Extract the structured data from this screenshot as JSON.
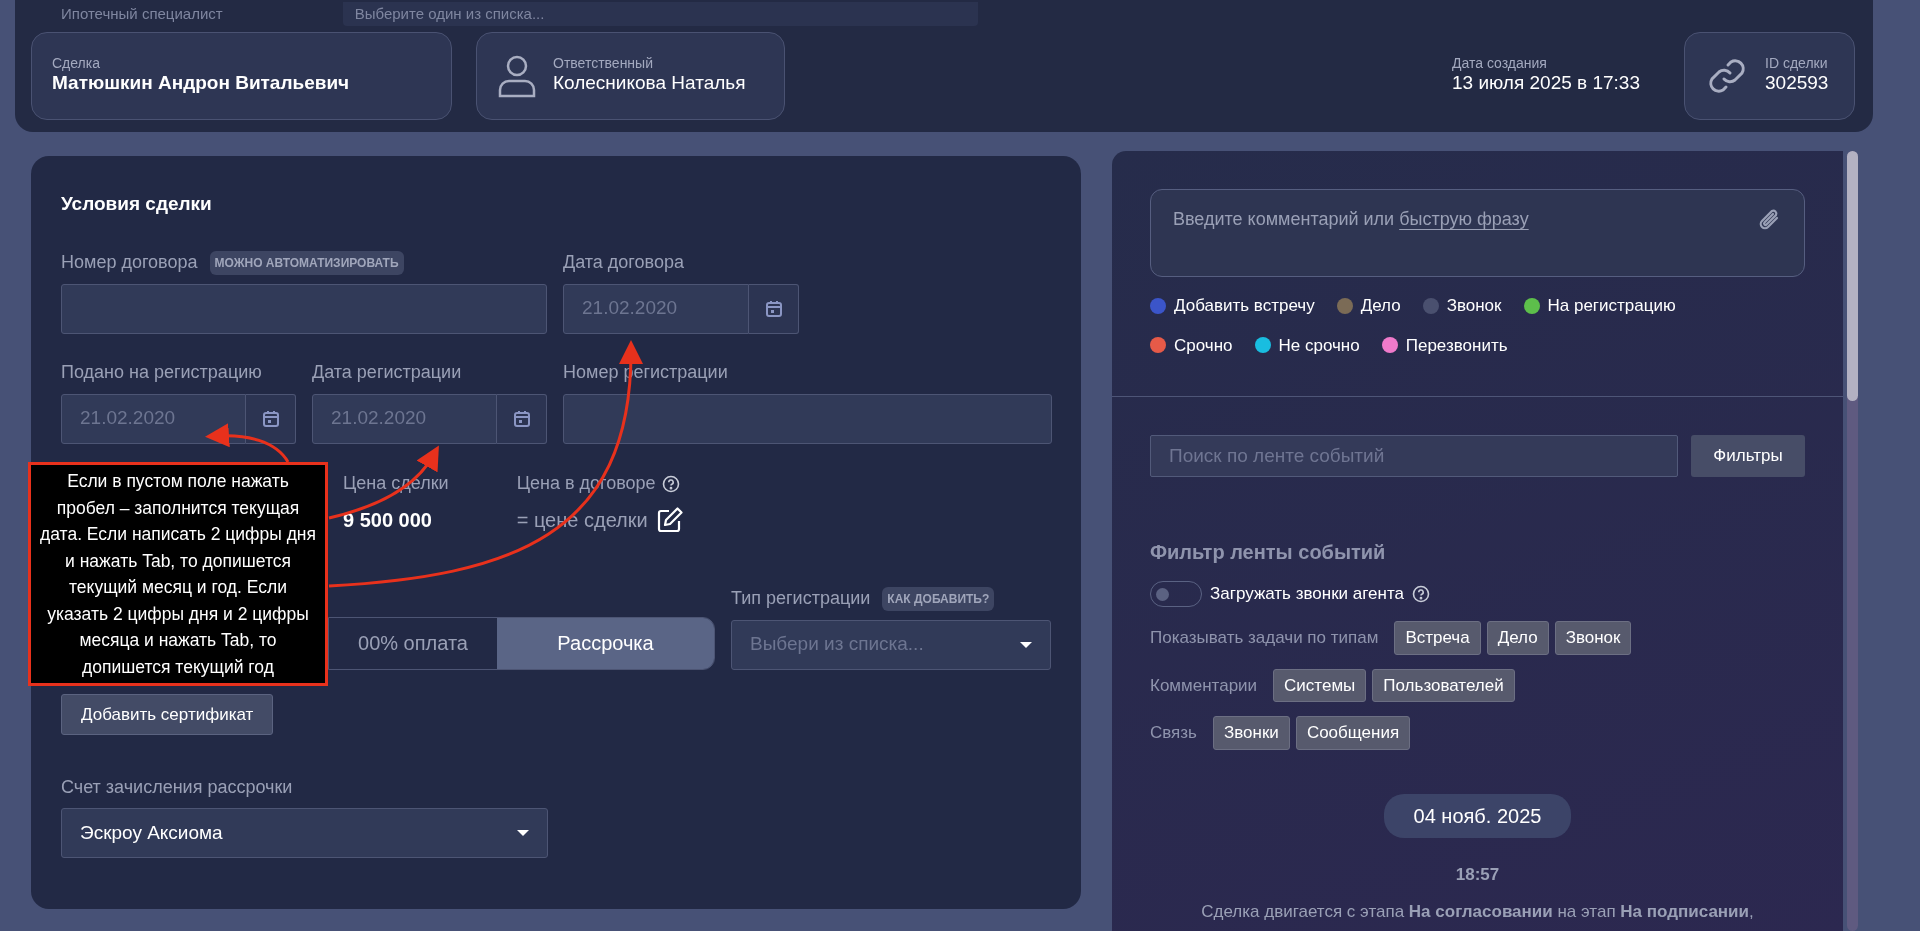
{
  "background_form": {
    "label": "Ипотечный специалист",
    "placeholder": "Выберите один из списка..."
  },
  "header": {
    "deal": {
      "label": "Сделка",
      "value": "Матюшкин Андрон Витальевич"
    },
    "responsible": {
      "label": "Ответственный",
      "value": "Колесникова Наталья"
    },
    "created": {
      "label": "Дата создания",
      "value": "13 июля 2025 в 17:33"
    },
    "deal_id": {
      "label": "ID сделки",
      "value": "302593"
    }
  },
  "conditions": {
    "title": "Условия сделки",
    "contract_number": {
      "label": "Номер договора",
      "badge": "МОЖНО АВТОМАТИЗИРОВАТЬ"
    },
    "contract_date": {
      "label": "Дата договора",
      "placeholder": "21.02.2020"
    },
    "submitted_date": {
      "label": "Подано на регистрацию",
      "placeholder": "21.02.2020"
    },
    "registration_date": {
      "label": "Дата регистрации",
      "placeholder": "21.02.2020"
    },
    "registration_number": {
      "label": "Номер регистрации"
    },
    "price": {
      "label": "Цена сделки",
      "value": "9 500 000"
    },
    "contract_price": {
      "label": "Цена в договоре",
      "value": "= цене сделки"
    },
    "payment_options": [
      {
        "label": "00% оплата",
        "selected": false
      },
      {
        "label": "Рассрочка",
        "selected": true
      }
    ],
    "registration_type": {
      "label": "Тип регистрации",
      "badge": "КАК ДОБАВИТЬ?",
      "placeholder": "Выбери из списка..."
    },
    "certificate_button": "Добавить сертификат",
    "installment_account": {
      "label": "Счет зачисления рассрочки",
      "value": "Эскроу Аксиома"
    },
    "tooltip": "Если в пустом поле нажать пробел – заполнится текущая дата. Если написать 2 цифры дня и нажать Tab, то допишется текущий месяц и год. Если указать 2 цифры дня и 2 цифры месяца и нажать Tab, то допишется текущий год"
  },
  "feed_panel": {
    "comment": {
      "placeholder": "Введите комментарий или",
      "link": "быструю фразу"
    },
    "legend": [
      {
        "label": "Добавить встречу",
        "color": "#3b55c9"
      },
      {
        "label": "Дело",
        "color": "#7b6b56"
      },
      {
        "label": "Звонок",
        "color": "#4a506f"
      },
      {
        "label": "На регистрацию",
        "color": "#5dbf4b"
      },
      {
        "label": "Срочно",
        "color": "#e65a48"
      },
      {
        "label": "Не срочно",
        "color": "#19bde0"
      },
      {
        "label": "Перезвонить",
        "color": "#ef7acb"
      }
    ],
    "search": {
      "placeholder": "Поиск по ленте событий",
      "button": "Фильтры"
    },
    "filter": {
      "title": "Фильтр ленты событий",
      "toggle": {
        "label": "Загружать звонки агента",
        "on": false
      },
      "groups": [
        {
          "label": "Показывать задачи по типам",
          "chips": [
            "Встреча",
            "Дело",
            "Звонок"
          ]
        },
        {
          "label": "Комментарии",
          "chips": [
            "Системы",
            "Пользователей"
          ]
        },
        {
          "label": "Связь",
          "chips": [
            "Звонки",
            "Сообщения"
          ]
        }
      ]
    },
    "date_pill": "04 нояб. 2025",
    "events": [
      {
        "time": "18:57",
        "text": "Сделка двигается с этапа **На согласовании** на этап **На подписании**,"
      }
    ]
  }
}
